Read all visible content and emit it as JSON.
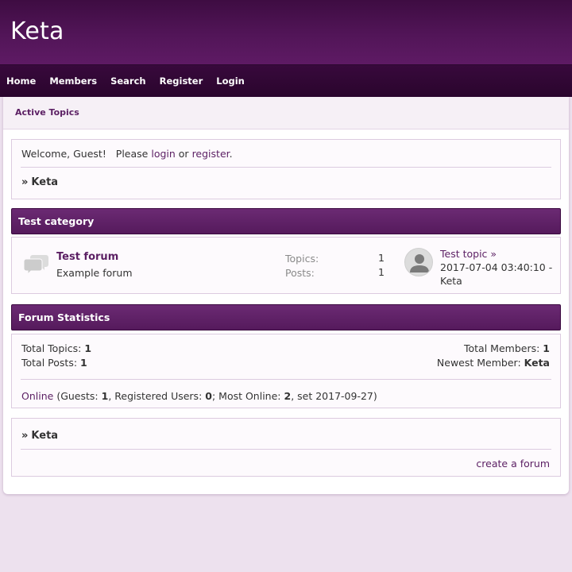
{
  "site": {
    "title": "Keta"
  },
  "nav": {
    "items": [
      "Home",
      "Members",
      "Search",
      "Register",
      "Login"
    ]
  },
  "subbar": {
    "active_topics": "Active Topics"
  },
  "welcome": {
    "greeting": "Welcome, Guest!",
    "please": "Please",
    "login": "login",
    "or": "or",
    "register": "register",
    "period": ".",
    "crumb": "Keta"
  },
  "category": {
    "title": "Test category",
    "forum": {
      "name": "Test forum",
      "description": "Example forum",
      "topics_label": "Topics:",
      "topics_value": "1",
      "posts_label": "Posts:",
      "posts_value": "1",
      "last_topic": "Test topic",
      "last_topic_arrow": "»",
      "last_date": "2017-07-04 03:40:10 -",
      "last_user": "Keta"
    }
  },
  "stats": {
    "title": "Forum Statistics",
    "total_topics_label": "Total Topics:",
    "total_topics": "1",
    "total_posts_label": "Total Posts:",
    "total_posts": "1",
    "total_members_label": "Total Members:",
    "total_members": "1",
    "newest_member_label": "Newest Member:",
    "newest_member": "Keta",
    "online_link": "Online",
    "guests_label": "(Guests:",
    "guests": "1",
    "registered_label": ", Registered Users:",
    "registered": "0",
    "most_online_label": "; Most Online:",
    "most_online": "2",
    "most_online_date": ", set 2017-09-27)"
  },
  "footer": {
    "crumb": "Keta",
    "create_forum": "create a forum"
  },
  "colors": {
    "header": "#521558",
    "nav": "#2a052d",
    "link": "#5b1f63",
    "background": "#ede1ee"
  }
}
